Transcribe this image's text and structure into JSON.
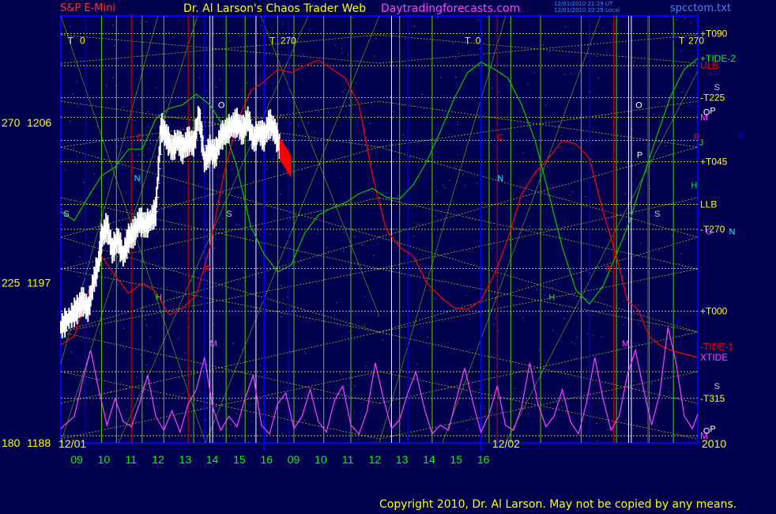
{
  "header": {
    "instrument": "S&P E-Mini",
    "site_title": "Dr. Al Larson's Chaos Trader Web",
    "site_url": "Daytradingforecasts.com",
    "file_name": "spcctom.txt",
    "timestamp_1": "12/01/2010 21:29 UT",
    "timestamp_2": "12/01/2010 20:29 Local"
  },
  "copyright": "Copyright 2010, Dr. Al Larson. May not be copied by any means.",
  "colors": {
    "background": "#00004f",
    "plot_border": "#0000ff",
    "price_bars": "#ffffff",
    "price_now": "#ff0000",
    "tide_1": "#ff0000",
    "tide_2": "#00cc00",
    "xtide": "#ff40ff",
    "grid_yellow": "#ffff00",
    "grid_green": "#66cc00",
    "title_red": "#ff3030",
    "title_yellow": "#ffff00",
    "site_magenta": "#ff40ff",
    "file_blue": "#4488ff"
  },
  "chart_data": {
    "type": "line",
    "xlabel": "",
    "ylabel": "",
    "x_range": [
      8.5,
      32.0
    ],
    "ylim": [
      1188,
      1212
    ],
    "date_labels": [
      {
        "label": "12/01",
        "x": 9
      },
      {
        "label": "12/02",
        "x": 25
      }
    ],
    "year_label": "2010",
    "x_ticks": [
      {
        "label": "09",
        "x": 9
      },
      {
        "label": "10",
        "x": 10
      },
      {
        "label": "11",
        "x": 11
      },
      {
        "label": "12",
        "x": 12
      },
      {
        "label": "13",
        "x": 13
      },
      {
        "label": "14",
        "x": 14
      },
      {
        "label": "15",
        "x": 15
      },
      {
        "label": "16",
        "x": 16
      },
      {
        "label": "09",
        "x": 17
      },
      {
        "label": "10",
        "x": 18
      },
      {
        "label": "11",
        "x": 19
      },
      {
        "label": "12",
        "x": 20
      },
      {
        "label": "13",
        "x": 21
      },
      {
        "label": "14",
        "x": 22
      },
      {
        "label": "15",
        "x": 23
      },
      {
        "label": "16",
        "x": 24
      }
    ],
    "y_ticks": [
      {
        "angle": "270",
        "price": "1206",
        "y": 1206
      },
      {
        "angle": "225",
        "price": "1197",
        "y": 1197
      },
      {
        "angle": "180",
        "price": "1188",
        "y": 1188
      }
    ],
    "right_labels": [
      {
        "text": "+T090",
        "y": 1211,
        "color": "#ffff00"
      },
      {
        "text": "+TIDE-2",
        "y": 1209.6,
        "color": "#00ff00"
      },
      {
        "text": "ULB",
        "y": 1209.2,
        "color": "#ff0000"
      },
      {
        "text": "-T225",
        "y": 1207.4,
        "color": "#ffff00"
      },
      {
        "text": "M",
        "y": 1206.3,
        "color": "#ff40ff"
      },
      {
        "text": "+T045",
        "y": 1203.8,
        "color": "#ffff00"
      },
      {
        "text": "LLB",
        "y": 1201.4,
        "color": "#ffff00"
      },
      {
        "text": "-T270",
        "y": 1200,
        "color": "#ffff00"
      },
      {
        "text": "+T000",
        "y": 1195.4,
        "color": "#ffff00"
      },
      {
        "text": "-TIDE-1",
        "y": 1193.4,
        "color": "#ff0000"
      },
      {
        "text": "XTIDE",
        "y": 1192.8,
        "color": "#ff40ff"
      },
      {
        "text": "-T315",
        "y": 1190.5,
        "color": "#ffff00"
      },
      {
        "text": "M",
        "y": 1188.4,
        "color": "#ff40ff"
      }
    ],
    "planet_labels": [
      {
        "text": "S",
        "x": 32.6,
        "y": 1208,
        "color": "#cccccc"
      },
      {
        "text": "O",
        "x": 32.2,
        "y": 1206.6,
        "color": "#ffffff"
      },
      {
        "text": "P",
        "x": 32.45,
        "y": 1206.7,
        "color": "#ffffff"
      },
      {
        "text": "R",
        "x": 31.85,
        "y": 1205.2,
        "color": "#ff0000"
      },
      {
        "text": "J",
        "x": 32.05,
        "y": 1204.9,
        "color": "#00ff00"
      },
      {
        "text": "U",
        "x": 33.5,
        "y": 1205.3,
        "color": "#0000ff"
      },
      {
        "text": "H",
        "x": 31.75,
        "y": 1202.5,
        "color": "#00ff00"
      },
      {
        "text": "C",
        "x": 32.3,
        "y": 1199.9,
        "color": "#ff40ff"
      },
      {
        "text": "N",
        "x": 33.15,
        "y": 1199.9,
        "color": "#00ffff"
      },
      {
        "text": "V",
        "x": 31.15,
        "y": 1194.9,
        "color": "#0000ff"
      },
      {
        "text": "S",
        "x": 32.6,
        "y": 1191.2,
        "color": "#cccccc"
      },
      {
        "text": "O",
        "x": 32.2,
        "y": 1188.7,
        "color": "#ffffff"
      },
      {
        "text": "P",
        "x": 32.45,
        "y": 1188.8,
        "color": "#ffffff"
      },
      {
        "text": "V",
        "x": 31.0,
        "y": 1210.8,
        "color": "#0000ff"
      },
      {
        "text": "C",
        "x": 11.3,
        "y": 1205.2,
        "color": "#ff0000"
      },
      {
        "text": "N",
        "x": 11.2,
        "y": 1202.9,
        "color": "#00ffff"
      },
      {
        "text": "O",
        "x": 14.3,
        "y": 1207.0,
        "color": "#ffffff"
      },
      {
        "text": "S",
        "x": 8.6,
        "y": 1200.9,
        "color": "#cccccc"
      },
      {
        "text": "S",
        "x": 14.6,
        "y": 1200.9,
        "color": "#cccccc"
      },
      {
        "text": "H",
        "x": 12.0,
        "y": 1196.2,
        "color": "#00ff00"
      },
      {
        "text": "R",
        "x": 13.8,
        "y": 1197.8,
        "color": "#ff0000"
      },
      {
        "text": "M",
        "x": 14.0,
        "y": 1193.6,
        "color": "#ff40ff"
      },
      {
        "text": "C",
        "x": 24.6,
        "y": 1205.2,
        "color": "#ff0000"
      },
      {
        "text": "N",
        "x": 24.6,
        "y": 1202.9,
        "color": "#00ffff"
      },
      {
        "text": "H",
        "x": 26.5,
        "y": 1196.2,
        "color": "#00ff00"
      },
      {
        "text": "R",
        "x": 28.6,
        "y": 1197.8,
        "color": "#ff0000"
      },
      {
        "text": "O",
        "x": 29.7,
        "y": 1207.0,
        "color": "#ffffff"
      },
      {
        "text": "P",
        "x": 29.75,
        "y": 1204.2,
        "color": "#ffffff"
      },
      {
        "text": "S",
        "x": 30.4,
        "y": 1200.9,
        "color": "#cccccc"
      },
      {
        "text": "M",
        "x": 29.2,
        "y": 1193.6,
        "color": "#ff40ff"
      }
    ],
    "angle_marks": [
      {
        "text": "T",
        "x": 8.75,
        "y": 1210.6
      },
      {
        "text": "0",
        "x": 9.2,
        "y": 1210.6
      },
      {
        "text": "T",
        "x": 16.2,
        "y": 1210.6
      },
      {
        "text": "270",
        "x": 16.6,
        "y": 1210.6
      },
      {
        "text": "T",
        "x": 23.4,
        "y": 1210.6
      },
      {
        "text": "0",
        "x": 23.8,
        "y": 1210.6
      },
      {
        "text": "T",
        "x": 31.3,
        "y": 1210.6
      },
      {
        "text": "270",
        "x": 31.65,
        "y": 1210.6
      }
    ],
    "vlines_green": [
      10.0,
      10.55,
      11.5,
      12.3,
      13.4,
      14.6,
      15.3,
      16.5,
      17.1,
      18.2,
      19.2,
      21.0,
      22.2,
      24.3,
      25.1,
      26.2,
      27.7,
      29.0,
      30.2,
      31.1
    ],
    "vlines_red": [
      11.1,
      13.2,
      24.6,
      28.9,
      30.15
    ],
    "vlines_white": [
      14.0,
      14.1,
      15.7,
      20.7,
      29.45,
      29.55
    ],
    "vlines_blue": [
      9.4,
      13.8,
      16.9,
      21.3,
      24.0,
      28.0
    ],
    "hlines_yellow": [
      1211,
      1209.2,
      1207.4,
      1206.3,
      1203.8,
      1201.4,
      1200.0,
      1195.4,
      1190.5,
      1188.4,
      1205.0,
      1197.8,
      1192.0
    ],
    "series": [
      {
        "name": "Tide-1",
        "color": "#ff0000",
        "x": [
          8.5,
          9.0,
          9.4,
          10.0,
          10.6,
          11.0,
          11.5,
          12.0,
          12.5,
          13.0,
          13.5,
          14.0,
          14.5,
          15.0,
          15.5,
          16.0,
          16.5,
          17.0,
          17.5,
          18.0,
          18.5,
          19.0,
          19.5,
          20.0,
          20.5,
          21.0,
          21.5,
          22.0,
          22.5,
          23.0,
          23.5,
          24.0,
          24.5,
          25.0,
          25.5,
          26.0,
          26.5,
          27.0,
          27.5,
          28.0,
          28.5,
          29.0,
          29.4,
          29.8,
          30.2,
          30.6,
          31.0,
          31.5,
          32.0
        ],
        "y": [
          1193.5,
          1194.0,
          1196.0,
          1198.5,
          1197.2,
          1196.4,
          1197.0,
          1196.5,
          1195.2,
          1195.6,
          1196.3,
          1199.0,
          1203.0,
          1206.0,
          1207.8,
          1208.3,
          1209.0,
          1208.8,
          1209.2,
          1209.5,
          1209.0,
          1208.5,
          1207.0,
          1203.0,
          1200.0,
          1199.0,
          1198.5,
          1197.0,
          1196.2,
          1195.6,
          1195.5,
          1196.0,
          1197.5,
          1199.5,
          1202.0,
          1203.2,
          1204.0,
          1205.0,
          1204.8,
          1204.0,
          1201.0,
          1198.5,
          1196.0,
          1195.5,
          1194.0,
          1193.5,
          1193.2,
          1193.0,
          1192.8
        ]
      },
      {
        "name": "Tide-2",
        "color": "#00cc00",
        "x": [
          8.5,
          9.0,
          9.5,
          10.0,
          10.5,
          11.0,
          11.5,
          12.0,
          12.5,
          13.0,
          13.5,
          14.0,
          14.5,
          15.0,
          15.5,
          16.0,
          16.5,
          17.0,
          17.5,
          18.0,
          18.5,
          19.0,
          19.5,
          20.0,
          20.5,
          21.0,
          21.5,
          22.0,
          22.5,
          23.0,
          23.5,
          24.0,
          24.5,
          25.0,
          25.5,
          26.0,
          26.5,
          27.0,
          27.5,
          28.0,
          28.5,
          29.0,
          29.5,
          30.0,
          30.5,
          31.0,
          31.5,
          32.0
        ],
        "y": [
          1201.0,
          1200.5,
          1201.8,
          1203.0,
          1203.5,
          1204.5,
          1204.5,
          1206.2,
          1206.8,
          1207.0,
          1207.6,
          1207.0,
          1205.8,
          1203.5,
          1200.2,
          1198.6,
          1197.6,
          1198.0,
          1199.8,
          1200.8,
          1201.2,
          1201.5,
          1202.0,
          1202.3,
          1201.8,
          1201.7,
          1202.5,
          1203.8,
          1205.5,
          1207.3,
          1208.8,
          1209.4,
          1209.0,
          1208.5,
          1207.0,
          1205.0,
          1202.0,
          1199.0,
          1196.6,
          1195.8,
          1196.8,
          1198.6,
          1200.5,
          1203.0,
          1205.3,
          1207.5,
          1209.0,
          1209.6
        ]
      },
      {
        "name": "XTIDE",
        "color": "#ff40ff",
        "x": [
          8.5,
          9.0,
          9.3,
          9.6,
          9.9,
          10.2,
          10.5,
          10.8,
          11.1,
          11.4,
          11.7,
          12.0,
          12.3,
          12.6,
          12.9,
          13.2,
          13.5,
          13.8,
          14.1,
          14.4,
          14.7,
          15.0,
          15.3,
          15.6,
          15.9,
          16.2,
          16.5,
          16.8,
          17.1,
          17.4,
          17.7,
          18.0,
          18.3,
          18.6,
          18.9,
          19.2,
          19.5,
          19.8,
          20.1,
          20.4,
          20.7,
          21.0,
          21.3,
          21.6,
          21.9,
          22.2,
          22.5,
          22.8,
          23.1,
          23.4,
          23.7,
          24.0,
          24.3,
          24.6,
          24.9,
          25.2,
          25.5,
          25.8,
          26.1,
          26.4,
          26.7,
          27.0,
          27.3,
          27.6,
          27.9,
          28.2,
          28.5,
          28.8,
          29.1,
          29.4,
          29.7,
          30.0,
          30.3,
          30.6,
          30.9,
          31.2,
          31.5,
          31.8,
          32.0
        ],
        "y": [
          1188.8,
          1189.5,
          1191.5,
          1193.2,
          1191.0,
          1189.0,
          1190.5,
          1189.2,
          1188.9,
          1190.2,
          1191.8,
          1189.5,
          1188.7,
          1189.8,
          1188.6,
          1190.2,
          1191.0,
          1192.8,
          1190.0,
          1188.7,
          1189.5,
          1188.9,
          1190.5,
          1191.8,
          1189.0,
          1188.5,
          1190.2,
          1190.8,
          1188.8,
          1189.5,
          1191.0,
          1189.2,
          1188.6,
          1190.4,
          1191.2,
          1189.0,
          1188.5,
          1189.8,
          1192.5,
          1190.5,
          1188.8,
          1189.3,
          1190.8,
          1192.0,
          1190.0,
          1188.5,
          1189.0,
          1188.7,
          1190.5,
          1192.2,
          1190.3,
          1188.6,
          1189.6,
          1191.2,
          1189.0,
          1188.7,
          1190.0,
          1192.5,
          1190.2,
          1188.9,
          1189.5,
          1191.0,
          1189.2,
          1188.5,
          1190.3,
          1192.8,
          1190.5,
          1188.7,
          1189.5,
          1191.8,
          1193.2,
          1191.0,
          1189.0,
          1190.8,
          1194.5,
          1192.5,
          1189.5,
          1188.8,
          1189.6
        ]
      }
    ],
    "price": {
      "name": "S&P E-Mini",
      "color": "#ffffff",
      "x": [
        8.5,
        8.8,
        9.1,
        9.3,
        9.5,
        9.7,
        9.9,
        10.0,
        10.2,
        10.4,
        10.6,
        10.8,
        11.0,
        11.2,
        11.4,
        11.6,
        11.8,
        12.0,
        12.2,
        12.4,
        12.6,
        12.8,
        13.0,
        13.2,
        13.4,
        13.6,
        13.8,
        14.0,
        14.2,
        14.4,
        14.6,
        14.8,
        15.0,
        15.2,
        15.4,
        15.6,
        15.8,
        16.0,
        16.2,
        16.4,
        16.6
      ],
      "y": [
        1194.5,
        1195.0,
        1195.5,
        1196.0,
        1195.5,
        1197.0,
        1198.2,
        1199.5,
        1200.2,
        1198.8,
        1199.5,
        1198.5,
        1199.5,
        1199.8,
        1200.5,
        1200.2,
        1200.5,
        1201.0,
        1205.8,
        1205.2,
        1204.5,
        1205.0,
        1204.5,
        1205.0,
        1204.8,
        1206.5,
        1203.8,
        1204.5,
        1204.2,
        1205.2,
        1205.5,
        1205.8,
        1206.0,
        1205.5,
        1206.2,
        1205.0,
        1205.5,
        1205.2,
        1206.0,
        1205.5,
        1204.5
      ]
    },
    "price_now": {
      "x": [
        16.6,
        16.8,
        17.0
      ],
      "y": [
        1204.5,
        1204.0,
        1203.5
      ]
    },
    "grid_diagonal": true
  }
}
